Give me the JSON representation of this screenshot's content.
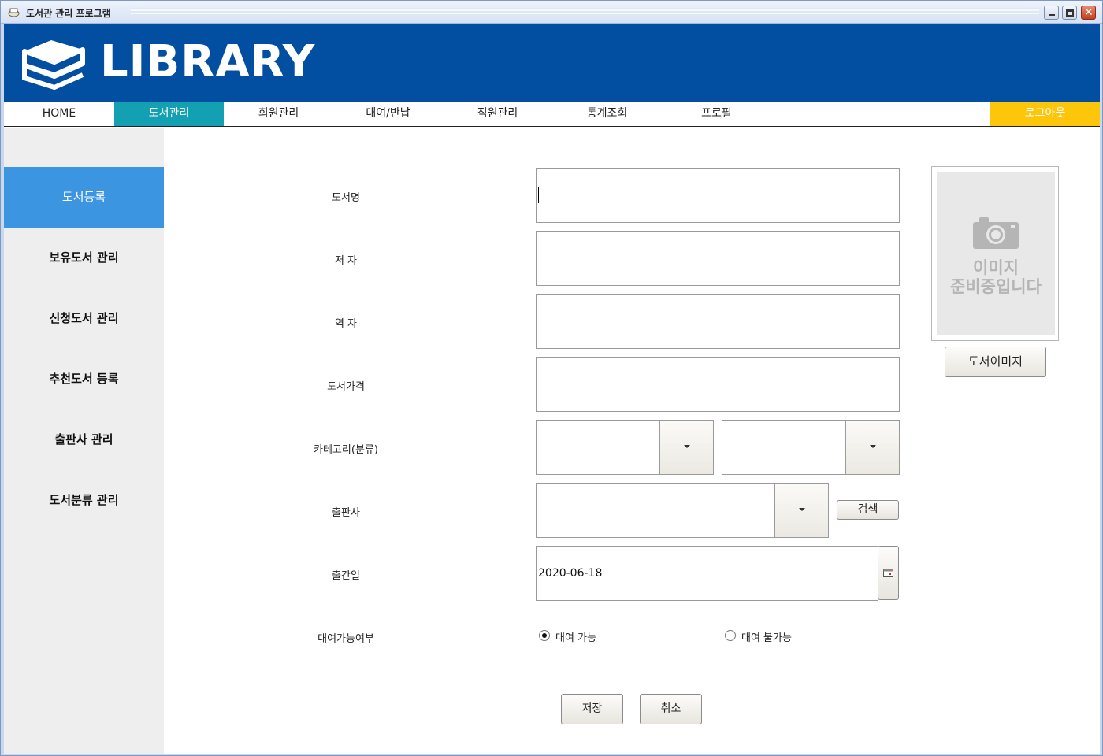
{
  "window": {
    "title": "도서관 관리 프로그램",
    "close_glyph": "✕"
  },
  "header": {
    "logo_text": "LIBRARY"
  },
  "nav": {
    "items": [
      "HOME",
      "도서관리",
      "회원관리",
      "대여/반납",
      "직원관리",
      "통계조회",
      "프로필"
    ],
    "active": "도서관리",
    "logout": "로그아웃"
  },
  "sidebar": {
    "items": [
      "도서등록",
      "보유도서 관리",
      "신청도서 관리",
      "추천도서 등록",
      "출판사 관리",
      "도서분류 관리"
    ],
    "active": "도서등록"
  },
  "form": {
    "title_label": "도서명",
    "title_value": "",
    "author_label": "저 자",
    "author_value": "",
    "translator_label": "역 자",
    "translator_value": "",
    "price_label": "도서가격",
    "price_value": "",
    "category_label": "카테고리(분류)",
    "category_major": "",
    "category_minor": "",
    "publisher_label": "출판사",
    "publisher_value": "",
    "search_button": "검색",
    "pubdate_label": "출간일",
    "pubdate_value": "2020-06-18",
    "rental_label": "대여가능여부",
    "rental_options": [
      "대여 가능",
      "대여 불가능"
    ],
    "rental_selected": "대여 가능",
    "save_button": "저장",
    "cancel_button": "취소"
  },
  "image_panel": {
    "placeholder_line1": "이미지",
    "placeholder_line2": "준비중입니다",
    "button": "도서이미지"
  },
  "colors": {
    "header_bg": "#024ea1",
    "nav_active": "#14a0b3",
    "logout_bg": "#fdc60a",
    "sidebar_active": "#3b95e0",
    "sidebar_bg": "#eeeeee"
  }
}
